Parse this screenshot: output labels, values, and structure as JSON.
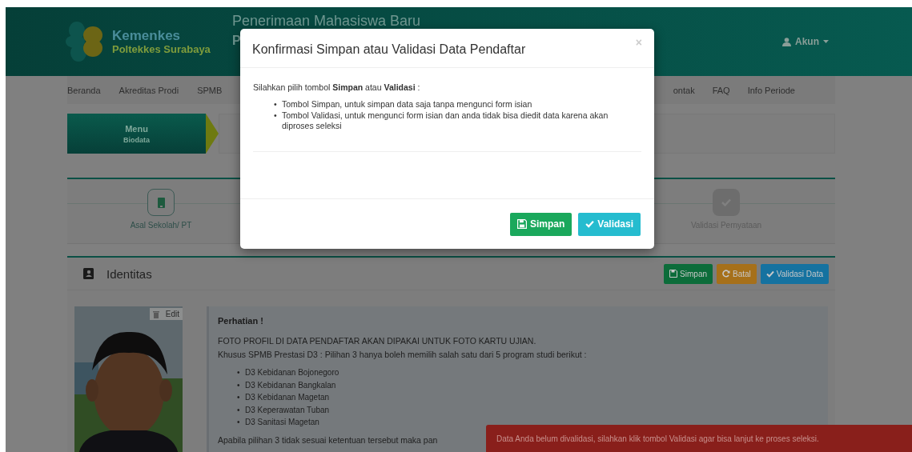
{
  "header": {
    "brand": "Kemenkes",
    "brand_sub": "Poltekkes Surabaya",
    "title": "Penerimaan Mahasiswa Baru",
    "subtitle": "P",
    "account": "Akun"
  },
  "nav_left": [
    "Beranda",
    "Akreditas Prodi",
    "SPMB"
  ],
  "nav_right": [
    "ontak",
    "FAQ",
    "Info Periode"
  ],
  "menu_tab": {
    "title": "Menu",
    "subtitle": "Biodata"
  },
  "steps": [
    {
      "label": "Asal Sekolah/ PT",
      "active": true
    },
    {
      "label": "Validasi Pernyataan",
      "active": false
    }
  ],
  "panel": {
    "title": "Identitas",
    "buttons": [
      {
        "label": "Simpan",
        "kind": "save"
      },
      {
        "label": "Batal",
        "kind": "cancel"
      },
      {
        "label": "Validasi Data",
        "kind": "validate"
      }
    ]
  },
  "photo": {
    "kind": "picture",
    "edit_label": "Edit"
  },
  "notice": {
    "title": "Perhatian !",
    "lines": [
      "FOTO PROFIL DI DATA PENDAFTAR AKAN DIPAKAI UNTUK FOTO KARTU UJIAN.",
      "Khusus SPMB Prestasi D3 : Pilihan 3 hanya boleh memilih salah satu dari 5 program studi berikut :"
    ],
    "marker": "•",
    "programs": [
      "D3 Kebidanan Bojonegoro",
      "D3 Kebidanan Bangkalan",
      "D3 Kebidanan Magetan",
      "D3 Keperawatan Tuban",
      "D3 Sanitasi Magetan"
    ],
    "footer": "Apabila pilihan 3 tidak sesuai ketentuan tersebut maka pan"
  },
  "toast": "Data Anda belum divalidasi, silahkan klik tombol Validasi agar bisa lanjut ke proses seleksi.",
  "modal": {
    "title": "Konfirmasi Simpan atau Validasi Data Pendaftar",
    "close": "×",
    "intro": "Silahkan pilih tombol **Simpan** atau **Validasi** :",
    "marker": "•",
    "items": [
      "Tombol Simpan, untuk simpan data saja tanpa mengunci form isian",
      "Tombol Validasi, untuk mengunci form isian dan anda tidak bisa diedit data karena akan diproses seleksi"
    ],
    "buttons": [
      {
        "label": "Simpan",
        "kind": "save"
      },
      {
        "label": "Validasi",
        "kind": "validate"
      }
    ]
  }
}
